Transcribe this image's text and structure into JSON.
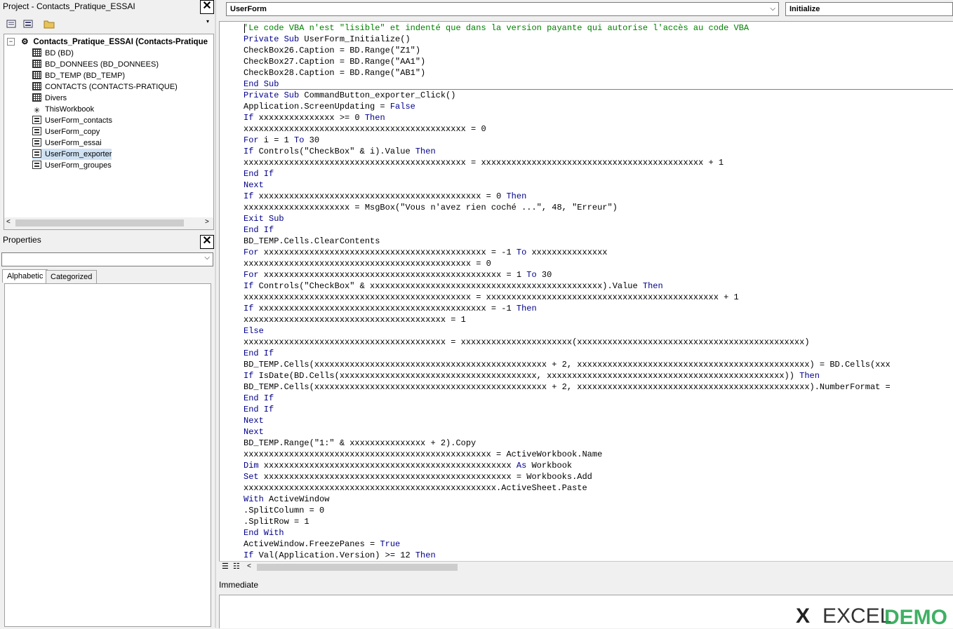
{
  "project": {
    "title": "Project - Contacts_Pratique_ESSAI",
    "root": "Contacts_Pratique_ESSAI (Contacts-Pratique",
    "items": [
      {
        "label": "BD (BD)",
        "icon": "sheet-icon"
      },
      {
        "label": "BD_DONNEES (BD_DONNEES)",
        "icon": "sheet-icon"
      },
      {
        "label": "BD_TEMP (BD_TEMP)",
        "icon": "sheet-icon"
      },
      {
        "label": "CONTACTS (CONTACTS-PRATIQUE)",
        "icon": "sheet-icon"
      },
      {
        "label": "Divers",
        "icon": "sheet-icon"
      },
      {
        "label": "ThisWorkbook",
        "icon": "workbook-icon"
      },
      {
        "label": "UserForm_contacts",
        "icon": "form-icon"
      },
      {
        "label": "UserForm_copy",
        "icon": "form-icon"
      },
      {
        "label": "UserForm_essai",
        "icon": "form-icon"
      },
      {
        "label": "UserForm_exporter",
        "icon": "form-icon",
        "selected": true
      },
      {
        "label": "UserForm_groupes",
        "icon": "form-icon"
      }
    ]
  },
  "properties": {
    "title": "Properties",
    "tabs": [
      "Alphabetic",
      "Categorized"
    ]
  },
  "editor": {
    "object_combo": "UserForm",
    "proc_combo": "Initialize",
    "lines": [
      "'Le code VBA n'est \"lisible\" et indenté que dans la version payante qui autorise l'accès au code VBA",
      "Private Sub UserForm_Initialize()",
      "CheckBox26.Caption = BD.Range(\"Z1\")",
      "CheckBox27.Caption = BD.Range(\"AA1\")",
      "CheckBox28.Caption = BD.Range(\"AB1\")",
      "End Sub",
      "Private Sub CommandButton_exporter_Click()",
      "Application.ScreenUpdating = False",
      "If xxxxxxxxxxxxxxx >= 0 Then",
      "xxxxxxxxxxxxxxxxxxxxxxxxxxxxxxxxxxxxxxxxxxxx = 0",
      "For i = 1 To 30",
      "If Controls(\"CheckBox\" & i).Value Then",
      "xxxxxxxxxxxxxxxxxxxxxxxxxxxxxxxxxxxxxxxxxxxx = xxxxxxxxxxxxxxxxxxxxxxxxxxxxxxxxxxxxxxxxxxxx + 1",
      "End If",
      "Next",
      "If xxxxxxxxxxxxxxxxxxxxxxxxxxxxxxxxxxxxxxxxxxxx = 0 Then",
      "xxxxxxxxxxxxxxxxxxxxx = MsgBox(\"Vous n'avez rien coché ...\", 48, \"Erreur\")",
      "Exit Sub",
      "End If",
      "BD_TEMP.Cells.ClearContents",
      "For xxxxxxxxxxxxxxxxxxxxxxxxxxxxxxxxxxxxxxxxxxxx = -1 To xxxxxxxxxxxxxxx",
      "xxxxxxxxxxxxxxxxxxxxxxxxxxxxxxxxxxxxxxxxxxxxx = 0",
      "For xxxxxxxxxxxxxxxxxxxxxxxxxxxxxxxxxxxxxxxxxxxxxxx = 1 To 30",
      "If Controls(\"CheckBox\" & xxxxxxxxxxxxxxxxxxxxxxxxxxxxxxxxxxxxxxxxxxxxxx).Value Then",
      "xxxxxxxxxxxxxxxxxxxxxxxxxxxxxxxxxxxxxxxxxxxxx = xxxxxxxxxxxxxxxxxxxxxxxxxxxxxxxxxxxxxxxxxxxxxx + 1",
      "If xxxxxxxxxxxxxxxxxxxxxxxxxxxxxxxxxxxxxxxxxxxxx = -1 Then",
      "xxxxxxxxxxxxxxxxxxxxxxxxxxxxxxxxxxxxxxxx = 1",
      "Else",
      "xxxxxxxxxxxxxxxxxxxxxxxxxxxxxxxxxxxxxxxx = xxxxxxxxxxxxxxxxxxxxxx(xxxxxxxxxxxxxxxxxxxxxxxxxxxxxxxxxxxxxxxxxxxxx)",
      "End If",
      "BD_TEMP.Cells(xxxxxxxxxxxxxxxxxxxxxxxxxxxxxxxxxxxxxxxxxxxxxx + 2, xxxxxxxxxxxxxxxxxxxxxxxxxxxxxxxxxxxxxxxxxxxxxx) = BD.Cells(xxx",
      "If IsDate(BD.Cells(xxxxxxxxxxxxxxxxxxxxxxxxxxxxxxxxxxxxxxx, xxxxxxxxxxxxxxxxxxxxxxxxxxxxxxxxxxxxxxxxxxxxxxx)) Then",
      "BD_TEMP.Cells(xxxxxxxxxxxxxxxxxxxxxxxxxxxxxxxxxxxxxxxxxxxxxx + 2, xxxxxxxxxxxxxxxxxxxxxxxxxxxxxxxxxxxxxxxxxxxxxx).NumberFormat =",
      "End If",
      "End If",
      "Next",
      "Next",
      "BD_TEMP.Range(\"1:\" & xxxxxxxxxxxxxxx + 2).Copy",
      "xxxxxxxxxxxxxxxxxxxxxxxxxxxxxxxxxxxxxxxxxxxxxxxxx = ActiveWorkbook.Name",
      "Dim xxxxxxxxxxxxxxxxxxxxxxxxxxxxxxxxxxxxxxxxxxxxxxxxx As Workbook",
      "Set xxxxxxxxxxxxxxxxxxxxxxxxxxxxxxxxxxxxxxxxxxxxxxxxx = Workbooks.Add",
      "xxxxxxxxxxxxxxxxxxxxxxxxxxxxxxxxxxxxxxxxxxxxxxxxxx.ActiveSheet.Paste",
      "With ActiveWindow",
      ".SplitColumn = 0",
      ".SplitRow = 1",
      "End With",
      "ActiveWindow.FreezePanes = True",
      "If Val(Application.Version) >= 12 Then"
    ]
  },
  "immediate": {
    "title": "Immediate"
  },
  "watermark": {
    "text": "EXCEL"
  }
}
